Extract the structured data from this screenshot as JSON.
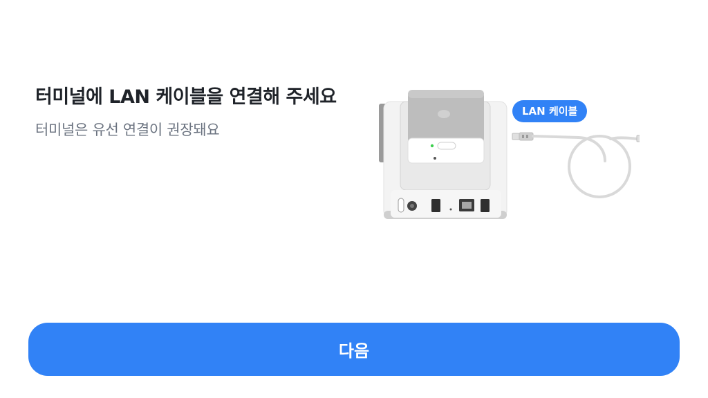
{
  "content": {
    "title": "터미널에 LAN 케이블을 연결해 주세요",
    "subtitle": "터미널은 유선 연결이 권장돼요"
  },
  "illustration": {
    "cable_label": "LAN 케이블"
  },
  "footer": {
    "next_label": "다음"
  },
  "colors": {
    "accent": "#3182f6",
    "title": "#1f2329",
    "subtitle": "#6b7380"
  }
}
